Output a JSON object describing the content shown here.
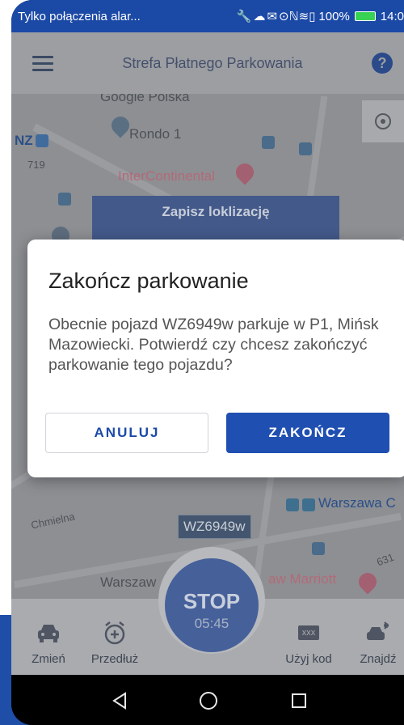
{
  "status_bar": {
    "notification_text": "Tylko połączenia alar...",
    "notification_icons": "🔧☁✉",
    "system_icons": "⊙ℕ≋▯",
    "battery_percent": "100%",
    "clock": "14:0"
  },
  "app_bar": {
    "title": "Strefa Płatnego Parkowania",
    "help_symbol": "?"
  },
  "map": {
    "labels": {
      "google": "Google Polska",
      "rondo": "Rondo 1",
      "nz": "NZ",
      "num719": "719",
      "intercontinental": "InterContinental",
      "chmielna": "Chmielna",
      "warszawa_c": "Warszawa C",
      "marriott": "aw Marriott",
      "num631": "631",
      "warszaw": "Warszaw"
    },
    "save_location_label": "Zapisz loklizację",
    "vehicle_plate": "WZ6949w"
  },
  "dialog": {
    "title": "Zakończ parkowanie",
    "body": "Obecnie pojazd WZ6949w parkuje w P1, Mińsk Mazowiecki. Potwierdź czy chcesz zakończyć parkowanie tego pojazdu?",
    "cancel_label": "ANULUJ",
    "confirm_label": "ZAKOŃCZ"
  },
  "bottom_nav": {
    "items": [
      {
        "label": "Zmień",
        "icon": "car-icon"
      },
      {
        "label": "Przedłuż",
        "icon": "alarm-plus-icon"
      },
      {
        "label": "Użyj kod",
        "icon": "code-icon",
        "icon_text": "xxx"
      },
      {
        "label": "Znajdź",
        "icon": "find-car-icon"
      }
    ],
    "stop": {
      "label": "STOP",
      "time": "05:45"
    }
  },
  "colors": {
    "brand_blue": "#1f4fb1",
    "status_bar": "#1b49a6",
    "dim_map": "#8d8f93"
  }
}
